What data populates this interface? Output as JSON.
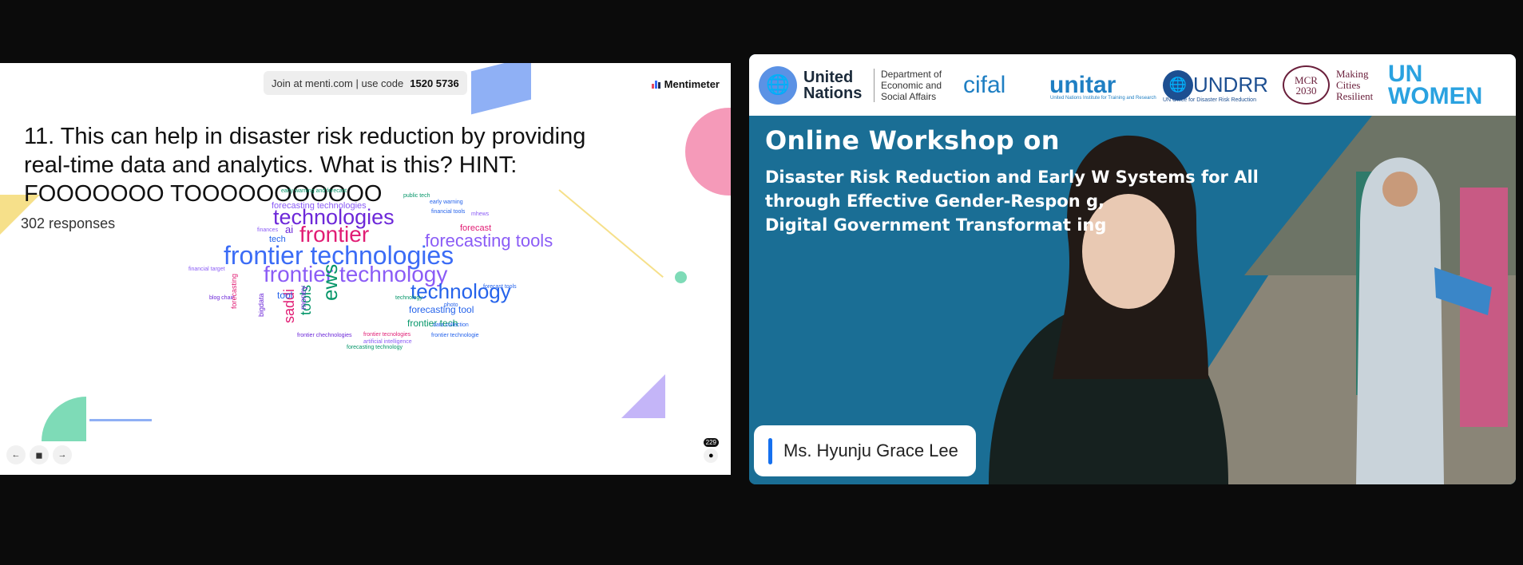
{
  "slide": {
    "join_text": "Join at menti.com | use code",
    "join_code": "1520 5736",
    "brand": "Mentimeter",
    "question": "11. This can help in disaster risk reduction by providing real-time data and analytics. What is this? HINT: FOOOOOOO TOOOOOOOOOOO",
    "responses": "302 responses",
    "participants": "229",
    "nav": {
      "prev": "←",
      "menu": "◼",
      "next": "→"
    },
    "word_cloud": [
      {
        "text": "frontier technologies",
        "color": "#3b6cf6"
      },
      {
        "text": "frontier technology",
        "color": "#8b5cf6"
      },
      {
        "text": "technologies",
        "color": "#6d28d9"
      },
      {
        "text": "frontier",
        "color": "#e11d74"
      },
      {
        "text": "forecasting tools",
        "color": "#8b5cf6"
      },
      {
        "text": "technology",
        "color": "#2563eb"
      },
      {
        "text": "ews",
        "color": "#059669"
      },
      {
        "text": "tools",
        "color": "#059669"
      },
      {
        "text": "saddi",
        "color": "#e11d74"
      },
      {
        "text": "forecasting technologies",
        "color": "#8b5cf6"
      },
      {
        "text": "forecasting tool",
        "color": "#2563eb"
      },
      {
        "text": "frontier tech",
        "color": "#059669"
      },
      {
        "text": "forecast",
        "color": "#e11d74"
      },
      {
        "text": "ai",
        "color": "#6d28d9"
      },
      {
        "text": "tech",
        "color": "#2563eb"
      },
      {
        "text": "tool",
        "color": "#2563eb"
      },
      {
        "text": "artificial intelligence",
        "color": "#2563eb"
      },
      {
        "text": "early warning and forecast",
        "color": "#059669"
      },
      {
        "text": "public tech",
        "color": "#059669"
      },
      {
        "text": "early warning",
        "color": "#2563eb"
      },
      {
        "text": "financial tools",
        "color": "#2563eb"
      },
      {
        "text": "mhews",
        "color": "#8b5cf6"
      },
      {
        "text": "financial target",
        "color": "#8b5cf6"
      },
      {
        "text": "forecast tools",
        "color": "#2563eb"
      },
      {
        "text": "blog chain",
        "color": "#6d28d9"
      },
      {
        "text": "data collection",
        "color": "#2563eb"
      },
      {
        "text": "frontier technologie",
        "color": "#2563eb"
      },
      {
        "text": "frontier tecnologies",
        "color": "#e11d74"
      },
      {
        "text": "frontier chechnologies",
        "color": "#6d28d9"
      },
      {
        "text": "artificial intelligence",
        "color": "#8b5cf6"
      },
      {
        "text": "forecasting technology",
        "color": "#059669"
      },
      {
        "text": "forecasting",
        "color": "#e11d74"
      },
      {
        "text": "money",
        "color": "#6d28d9"
      },
      {
        "text": "photo",
        "color": "#2563eb"
      },
      {
        "text": "bigdata",
        "color": "#6d28d9"
      },
      {
        "text": "finances",
        "color": "#8b5cf6"
      },
      {
        "text": "technology",
        "color": "#059669"
      }
    ]
  },
  "video": {
    "logos": {
      "un_emblem": "globe-emblem-icon",
      "un_name": "United\nNations",
      "desa": "Department of\nEconomic and\nSocial Affairs",
      "cifal": "cifal",
      "unitar": "unitar",
      "unitar_sub": "United Nations Institute for Training and Research",
      "undrr": "UNDRR",
      "undrr_sub": "UN Office for Disaster Risk Reduction",
      "mcr": "MCR\n2030",
      "mcr_text": "Making\nCities\nResilient",
      "unwomen": "UN\nWOMEN"
    },
    "workshop_title": "Online Workshop on",
    "workshop_lines": [
      "Disaster Risk Reduction and Early W   Systems for All",
      "through Effective Gender-Respon        g,",
      "Digital Government Transformat          ing"
    ],
    "speaker_name": "Ms. Hyunju Grace Lee"
  }
}
